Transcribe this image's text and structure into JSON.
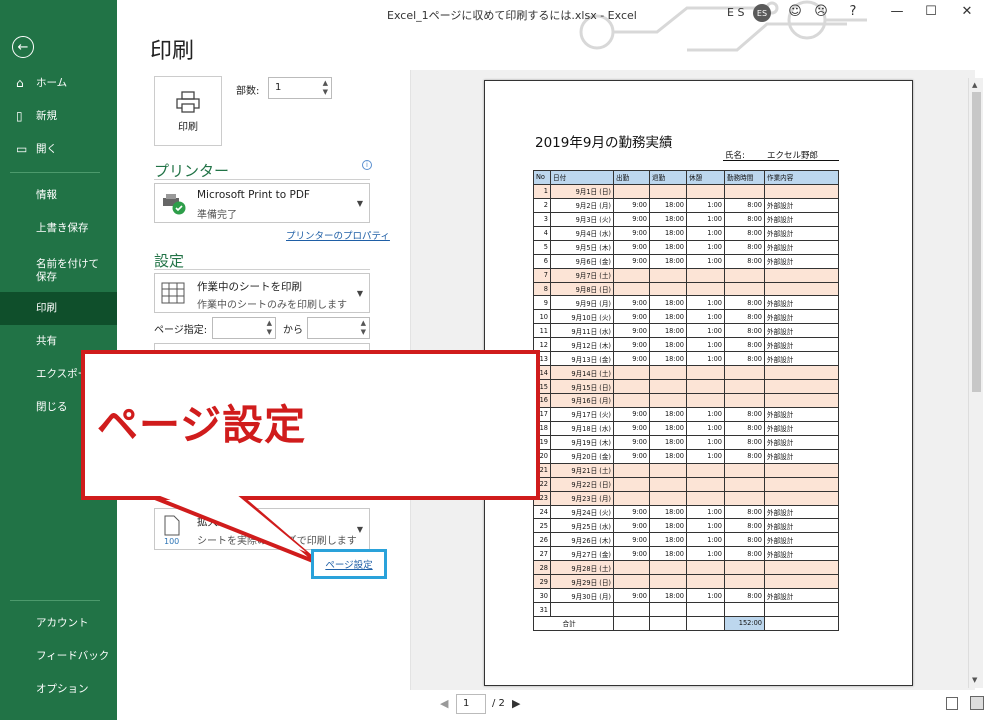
{
  "window": {
    "title": "Excel_1ページに収めて印刷するには.xlsx  -  Excel",
    "user_initials": "E S",
    "avatar": "ES",
    "buttons": [
      "☺",
      "☹",
      "?",
      "—",
      "☐",
      "✕"
    ]
  },
  "sidebar": {
    "items": [
      {
        "label": "ホーム",
        "icon": "home-icon"
      },
      {
        "label": "新規",
        "icon": "new-document-icon"
      },
      {
        "label": "開く",
        "icon": "folder-open-icon"
      },
      {
        "label": "情報"
      },
      {
        "label": "上書き保存"
      },
      {
        "label": "名前を付けて保存"
      },
      {
        "label": "印刷"
      },
      {
        "label": "共有"
      },
      {
        "label": "エクスポート"
      },
      {
        "label": "閉じる"
      },
      {
        "label": "アカウント"
      },
      {
        "label": "フィードバック"
      },
      {
        "label": "オプション"
      }
    ]
  },
  "print": {
    "title": "印刷",
    "print_button": "印刷",
    "copies_label": "部数:",
    "copies_value": "1",
    "printer_heading": "プリンター",
    "printer_name": "Microsoft Print to PDF",
    "printer_status": "準備完了",
    "printer_properties_link": "プリンターのプロパティ",
    "settings_heading": "設定",
    "print_what_main": "作業中のシートを印刷",
    "print_what_sub": "作業中のシートのみを印刷します",
    "page_range_label": "ページ指定:",
    "page_range_to": "から",
    "scaling_main": "拡大縮小なし",
    "scaling_sub": "シートを実際のサイズで印刷します",
    "page_setup_link": "ページ設定"
  },
  "callout": {
    "text": "ページ設定",
    "accent": "#d01c1c"
  },
  "preview": {
    "sheet_title": "2019年9月の勤務実績",
    "name_label": "氏名:",
    "name_value": "エクセル野郎",
    "headers": [
      "No",
      "日付",
      "出勤",
      "退勤",
      "休憩",
      "勤務時間",
      "作業内容"
    ],
    "rows": [
      {
        "no": "1",
        "date": "9月1日",
        "dow": "(日)",
        "in": "",
        "out": "",
        "brk": "",
        "hrs": "",
        "work": "",
        "weekend": true
      },
      {
        "no": "2",
        "date": "9月2日",
        "dow": "(月)",
        "in": "9:00",
        "out": "18:00",
        "brk": "1:00",
        "hrs": "8:00",
        "work": "外部設計",
        "weekend": false
      },
      {
        "no": "3",
        "date": "9月3日",
        "dow": "(火)",
        "in": "9:00",
        "out": "18:00",
        "brk": "1:00",
        "hrs": "8:00",
        "work": "外部設計",
        "weekend": false
      },
      {
        "no": "4",
        "date": "9月4日",
        "dow": "(水)",
        "in": "9:00",
        "out": "18:00",
        "brk": "1:00",
        "hrs": "8:00",
        "work": "外部設計",
        "weekend": false
      },
      {
        "no": "5",
        "date": "9月5日",
        "dow": "(木)",
        "in": "9:00",
        "out": "18:00",
        "brk": "1:00",
        "hrs": "8:00",
        "work": "外部設計",
        "weekend": false
      },
      {
        "no": "6",
        "date": "9月6日",
        "dow": "(金)",
        "in": "9:00",
        "out": "18:00",
        "brk": "1:00",
        "hrs": "8:00",
        "work": "外部設計",
        "weekend": false
      },
      {
        "no": "7",
        "date": "9月7日",
        "dow": "(土)",
        "in": "",
        "out": "",
        "brk": "",
        "hrs": "",
        "work": "",
        "weekend": true
      },
      {
        "no": "8",
        "date": "9月8日",
        "dow": "(日)",
        "in": "",
        "out": "",
        "brk": "",
        "hrs": "",
        "work": "",
        "weekend": true
      },
      {
        "no": "9",
        "date": "9月9日",
        "dow": "(月)",
        "in": "9:00",
        "out": "18:00",
        "brk": "1:00",
        "hrs": "8:00",
        "work": "外部設計",
        "weekend": false
      },
      {
        "no": "10",
        "date": "9月10日",
        "dow": "(火)",
        "in": "9:00",
        "out": "18:00",
        "brk": "1:00",
        "hrs": "8:00",
        "work": "外部設計",
        "weekend": false
      },
      {
        "no": "11",
        "date": "9月11日",
        "dow": "(水)",
        "in": "9:00",
        "out": "18:00",
        "brk": "1:00",
        "hrs": "8:00",
        "work": "外部設計",
        "weekend": false
      },
      {
        "no": "12",
        "date": "9月12日",
        "dow": "(木)",
        "in": "9:00",
        "out": "18:00",
        "brk": "1:00",
        "hrs": "8:00",
        "work": "外部設計",
        "weekend": false
      },
      {
        "no": "13",
        "date": "9月13日",
        "dow": "(金)",
        "in": "9:00",
        "out": "18:00",
        "brk": "1:00",
        "hrs": "8:00",
        "work": "外部設計",
        "weekend": false
      },
      {
        "no": "14",
        "date": "9月14日",
        "dow": "(土)",
        "in": "",
        "out": "",
        "brk": "",
        "hrs": "",
        "work": "",
        "weekend": true
      },
      {
        "no": "15",
        "date": "9月15日",
        "dow": "(日)",
        "in": "",
        "out": "",
        "brk": "",
        "hrs": "",
        "work": "",
        "weekend": true
      },
      {
        "no": "16",
        "date": "9月16日",
        "dow": "(月)",
        "in": "",
        "out": "",
        "brk": "",
        "hrs": "",
        "work": "",
        "weekend": true
      },
      {
        "no": "17",
        "date": "9月17日",
        "dow": "(火)",
        "in": "9:00",
        "out": "18:00",
        "brk": "1:00",
        "hrs": "8:00",
        "work": "外部設計",
        "weekend": false
      },
      {
        "no": "18",
        "date": "9月18日",
        "dow": "(水)",
        "in": "9:00",
        "out": "18:00",
        "brk": "1:00",
        "hrs": "8:00",
        "work": "外部設計",
        "weekend": false
      },
      {
        "no": "19",
        "date": "9月19日",
        "dow": "(木)",
        "in": "9:00",
        "out": "18:00",
        "brk": "1:00",
        "hrs": "8:00",
        "work": "外部設計",
        "weekend": false
      },
      {
        "no": "20",
        "date": "9月20日",
        "dow": "(金)",
        "in": "9:00",
        "out": "18:00",
        "brk": "1:00",
        "hrs": "8:00",
        "work": "外部設計",
        "weekend": false
      },
      {
        "no": "21",
        "date": "9月21日",
        "dow": "(土)",
        "in": "",
        "out": "",
        "brk": "",
        "hrs": "",
        "work": "",
        "weekend": true
      },
      {
        "no": "22",
        "date": "9月22日",
        "dow": "(日)",
        "in": "",
        "out": "",
        "brk": "",
        "hrs": "",
        "work": "",
        "weekend": true
      },
      {
        "no": "23",
        "date": "9月23日",
        "dow": "(月)",
        "in": "",
        "out": "",
        "brk": "",
        "hrs": "",
        "work": "",
        "weekend": true
      },
      {
        "no": "24",
        "date": "9月24日",
        "dow": "(火)",
        "in": "9:00",
        "out": "18:00",
        "brk": "1:00",
        "hrs": "8:00",
        "work": "外部設計",
        "weekend": false
      },
      {
        "no": "25",
        "date": "9月25日",
        "dow": "(水)",
        "in": "9:00",
        "out": "18:00",
        "brk": "1:00",
        "hrs": "8:00",
        "work": "外部設計",
        "weekend": false
      },
      {
        "no": "26",
        "date": "9月26日",
        "dow": "(木)",
        "in": "9:00",
        "out": "18:00",
        "brk": "1:00",
        "hrs": "8:00",
        "work": "外部設計",
        "weekend": false
      },
      {
        "no": "27",
        "date": "9月27日",
        "dow": "(金)",
        "in": "9:00",
        "out": "18:00",
        "brk": "1:00",
        "hrs": "8:00",
        "work": "外部設計",
        "weekend": false
      },
      {
        "no": "28",
        "date": "9月28日",
        "dow": "(土)",
        "in": "",
        "out": "",
        "brk": "",
        "hrs": "",
        "work": "",
        "weekend": true
      },
      {
        "no": "29",
        "date": "9月29日",
        "dow": "(日)",
        "in": "",
        "out": "",
        "brk": "",
        "hrs": "",
        "work": "",
        "weekend": true
      },
      {
        "no": "30",
        "date": "9月30日",
        "dow": "(月)",
        "in": "9:00",
        "out": "18:00",
        "brk": "1:00",
        "hrs": "8:00",
        "work": "外部設計",
        "weekend": false
      },
      {
        "no": "31",
        "date": "",
        "dow": "",
        "in": "",
        "out": "",
        "brk": "",
        "hrs": "",
        "work": "",
        "weekend": false
      }
    ],
    "total_label": "合計",
    "total_value": "152:00",
    "page_current": "1",
    "page_total": "/ 2"
  },
  "colors": {
    "sidebar": "#217346",
    "sidebar_active": "#0f4f2b",
    "header_fill": "#bdd7ee",
    "weekend_fill": "#fce4d6",
    "highlight_box": "#2aa2da"
  }
}
